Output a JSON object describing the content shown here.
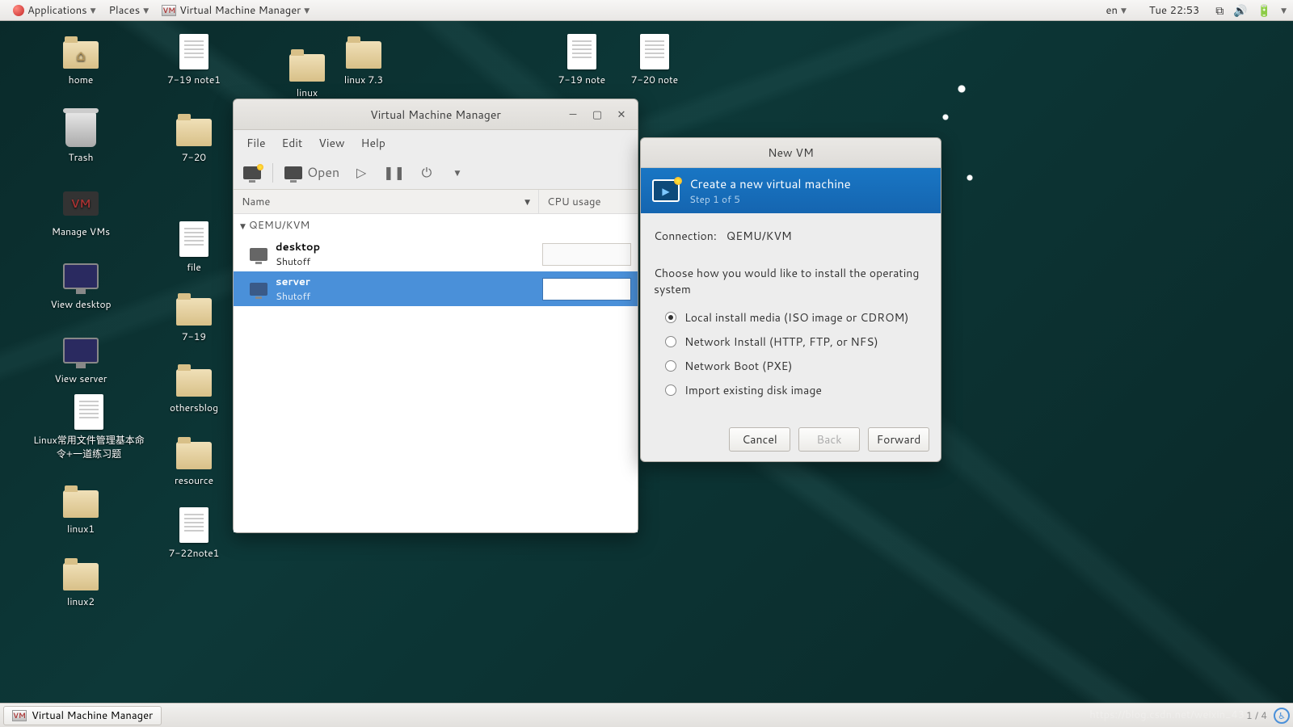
{
  "panel": {
    "applications": "Applications",
    "places": "Places",
    "active_app": "Virtual Machine Manager",
    "lang": "en",
    "clock": "Tue 22:53"
  },
  "taskbar": {
    "task1": "Virtual Machine Manager",
    "page_indicator": "1 / 4"
  },
  "desktop": {
    "home": "home",
    "trash": "Trash",
    "manage_vms": "Manage VMs",
    "view_desktop": "View desktop",
    "view_server": "View server",
    "linux_doc": "Linux常用文件管理基本命令+一道练习题",
    "linux1": "linux1",
    "linux2": "linux2",
    "note719_1": "7-19 note1",
    "f720": "7-20",
    "file": "file",
    "f719": "7-19",
    "othersblog": "othersblog",
    "resource": "resource",
    "note722_1": "7-22note1",
    "linux_fold": "linux",
    "linux73": "linux 7.3",
    "note719": "7-19 note",
    "note720": "7-20 note"
  },
  "vmm": {
    "title": "Virtual Machine Manager",
    "menu": {
      "file": "File",
      "edit": "Edit",
      "view": "View",
      "help": "Help"
    },
    "toolbar": {
      "open": "Open"
    },
    "columns": {
      "name": "Name",
      "cpu": "CPU usage"
    },
    "group": "QEMU/KVM",
    "vms": [
      {
        "name": "desktop",
        "state": "Shutoff"
      },
      {
        "name": "server",
        "state": "Shutoff"
      }
    ]
  },
  "newvm": {
    "title": "New VM",
    "heading": "Create a new virtual machine",
    "step": "Step 1 of 5",
    "connection_label": "Connection:",
    "connection_value": "QEMU/KVM",
    "choose_label": "Choose how you would like to install the operating system",
    "opt_local": "Local install media (ISO image or CDROM)",
    "opt_net": "Network Install (HTTP, FTP, or NFS)",
    "opt_pxe": "Network Boot (PXE)",
    "opt_import": "Import existing disk image",
    "btn_cancel": "Cancel",
    "btn_back": "Back",
    "btn_forward": "Forward"
  },
  "watermark": "https://blog.csdn.net/weixin_43"
}
